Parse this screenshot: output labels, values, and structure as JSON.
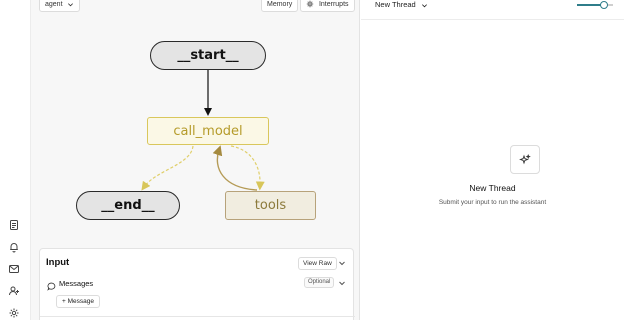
{
  "toolbar": {
    "assistant_select": "agent",
    "memory_label": "Memory",
    "interrupts_label": "Interrupts"
  },
  "graph": {
    "nodes": {
      "start": "__start__",
      "call_model": "call_model",
      "end": "__end__",
      "tools": "tools"
    },
    "colors": {
      "terminal_fill": "#e4e4e4",
      "call_model_fill": "#fbf8e6",
      "call_model_border": "#d9c75c",
      "tools_fill": "#f1ede0",
      "edge_conditional": "#e0cf6b",
      "edge_return": "#b59b56"
    }
  },
  "sidebar": {
    "icons": [
      "document-icon",
      "bell-icon",
      "mail-icon",
      "user-add-icon",
      "settings-icon"
    ]
  },
  "input_panel": {
    "title": "Input",
    "view_raw_label": "View Raw",
    "messages_label": "Messages",
    "optional_badge": "Optional",
    "add_message_label": "+ Message"
  },
  "thread": {
    "selector_label": "New Thread",
    "empty_title": "New Thread",
    "empty_subtitle": "Submit your input to run the assistant",
    "slider_value": 0.75,
    "accent_color": "#2f7d8a"
  }
}
